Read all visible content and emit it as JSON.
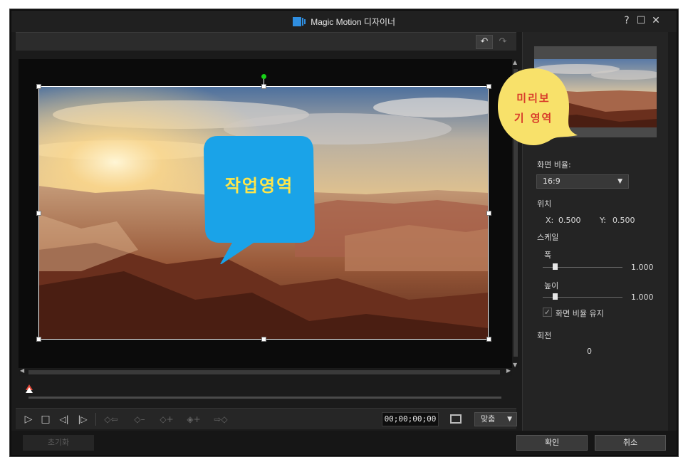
{
  "window": {
    "title": "Magic Motion 디자이너",
    "help": "?",
    "maximize": "☐",
    "close": "✕"
  },
  "toolbar": {
    "undo": "↶",
    "redo": "↷"
  },
  "work_area": {
    "callout": "작업영역"
  },
  "preview_area": {
    "callout_line1": "미리보",
    "callout_line2": "기 영역"
  },
  "panel": {
    "aspect_label": "화면 비율:",
    "aspect_value": "16:9",
    "position_label": "위치",
    "x_label": "X:",
    "x_value": "0.500",
    "y_label": "Y:",
    "y_value": "0.500",
    "scale_label": "스케일",
    "width_label": "폭",
    "width_value": "1.000",
    "height_label": "높이",
    "height_value": "1.000",
    "keep_ratio_label": "화면 비율 유지",
    "keep_ratio_checked": true,
    "rotation_label": "회전",
    "rotation_value": "0"
  },
  "controls": {
    "play": "▷",
    "stop": "□",
    "prev_frame": "◁|",
    "next_frame": "|▷",
    "kf_prev": "◇⇦",
    "kf_remove": "◇–",
    "kf_add": "◇+",
    "kf_dup": "◈+",
    "kf_next": "⇨◇",
    "timecode": "00;00;00;00",
    "fit_value": "맞춤"
  },
  "buttons": {
    "reset": "초기화",
    "ok": "확인",
    "cancel": "취소"
  },
  "colors": {
    "accent_blue": "#1aa3e8",
    "callout_yellow": "#f8e16a",
    "rotation_handle": "#18d018"
  }
}
